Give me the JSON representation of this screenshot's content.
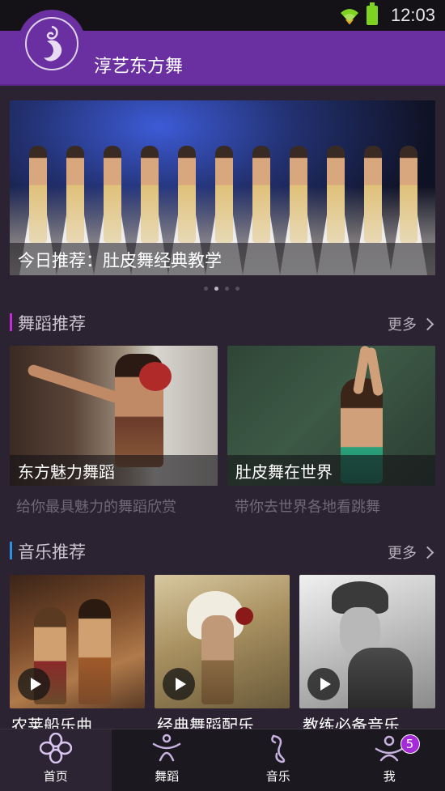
{
  "status_bar": {
    "time": "12:03"
  },
  "header": {
    "title": "淳艺东方舞"
  },
  "banner": {
    "caption": "今日推荐：肚皮舞经典教学",
    "pages": 4,
    "active_page": 1
  },
  "dance_section": {
    "title": "舞蹈推荐",
    "more": "更多",
    "accent": "#c32bd8",
    "cards": [
      {
        "title": "东方魅力舞蹈",
        "subtitle": "给你最具魅力的舞蹈欣赏"
      },
      {
        "title": "肚皮舞在世界",
        "subtitle": "带你去世界各地看跳舞"
      }
    ]
  },
  "music_section": {
    "title": "音乐推荐",
    "more": "更多",
    "accent": "#2f8fe0",
    "cards": [
      {
        "title": "农莱船乐曲"
      },
      {
        "title": "经典舞蹈配乐"
      },
      {
        "title": "教练必备音乐"
      }
    ]
  },
  "bottom_nav": {
    "items": [
      {
        "label": "首页",
        "icon": "flower-icon",
        "active": true
      },
      {
        "label": "舞蹈",
        "icon": "dancer-icon",
        "active": false
      },
      {
        "label": "音乐",
        "icon": "music-note-icon",
        "active": false
      },
      {
        "label": "我",
        "icon": "profile-icon",
        "active": false,
        "badge": "5"
      }
    ]
  },
  "colors": {
    "brand": "#6a2fa0",
    "background": "#2b2331",
    "nav": "#1c1820"
  }
}
